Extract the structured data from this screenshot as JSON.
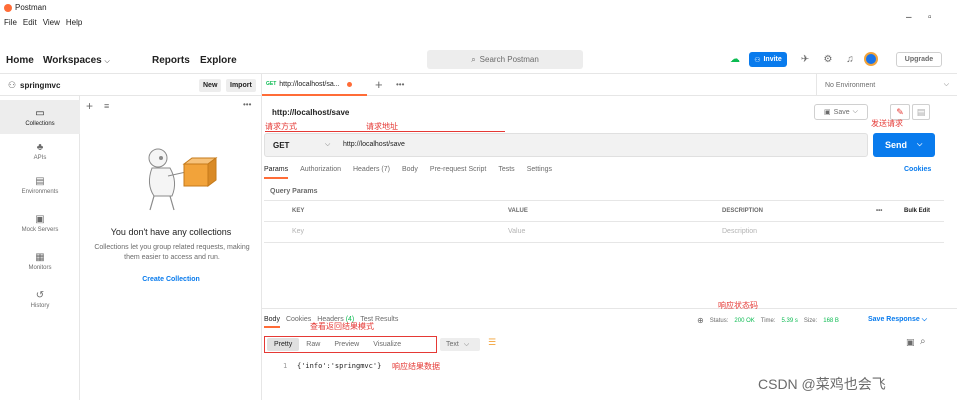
{
  "app": {
    "title": "Postman",
    "menu": [
      "File",
      "Edit",
      "View",
      "Help"
    ]
  },
  "topnav": {
    "home": "Home",
    "workspaces": "Workspaces",
    "reports": "Reports",
    "explore": "Explore",
    "search_placeholder": "Search Postman",
    "invite": "Invite",
    "upgrade": "Upgrade"
  },
  "workspace": {
    "name": "springmvc",
    "new": "New",
    "import": "Import"
  },
  "sidebar": {
    "items": [
      {
        "label": "Collections",
        "icon": "collections-icon"
      },
      {
        "label": "APIs",
        "icon": "apis-icon"
      },
      {
        "label": "Environments",
        "icon": "environments-icon"
      },
      {
        "label": "Mock Servers",
        "icon": "mock-servers-icon"
      },
      {
        "label": "Monitors",
        "icon": "monitors-icon"
      },
      {
        "label": "History",
        "icon": "history-icon"
      }
    ]
  },
  "collections": {
    "empty_title": "You don't have any collections",
    "empty_desc": "Collections let you group related requests, making them easier to access and run.",
    "create": "Create Collection"
  },
  "tab": {
    "method": "GET",
    "title": "http://localhost/sa...",
    "environment": "No Environment"
  },
  "request": {
    "name": "http://localhost/save",
    "save": "Save",
    "method": "GET",
    "url": "http://localhost/save",
    "send": "Send",
    "tabs": [
      "Params",
      "Authorization",
      "Headers (7)",
      "Body",
      "Pre-request Script",
      "Tests",
      "Settings"
    ],
    "cookies": "Cookies",
    "query_params_title": "Query Params",
    "table": {
      "headers": [
        "KEY",
        "VALUE",
        "DESCRIPTION"
      ],
      "placeholders": [
        "Key",
        "Value",
        "Description"
      ],
      "bulk_edit": "Bulk Edit",
      "more": "•••"
    }
  },
  "response": {
    "tabs": {
      "body": "Body",
      "cookies": "Cookies",
      "headers": "Headers",
      "headers_count": "(4)",
      "tests": "Test Results"
    },
    "status_label": "Status:",
    "status": "200 OK",
    "time_label": "Time:",
    "time": "5.39 s",
    "size_label": "Size:",
    "size": "168 B",
    "save_response": "Save Response",
    "views": [
      "Pretty",
      "Raw",
      "Preview",
      "Visualize"
    ],
    "format": "Text",
    "line_number": "1",
    "body_text": "{'info':'springmvc'}"
  },
  "annotations": {
    "method": "请求方式",
    "address": "请求地址",
    "send": "发送请求",
    "status": "响应状态码",
    "mode": "查看返回结果模式",
    "data": "响应结果数据"
  },
  "watermark": "CSDN @菜鸡也会飞",
  "colors": {
    "accent": "#ff6c37",
    "primary": "#097bed",
    "success": "#0cbb52",
    "annotation": "#e53935"
  }
}
